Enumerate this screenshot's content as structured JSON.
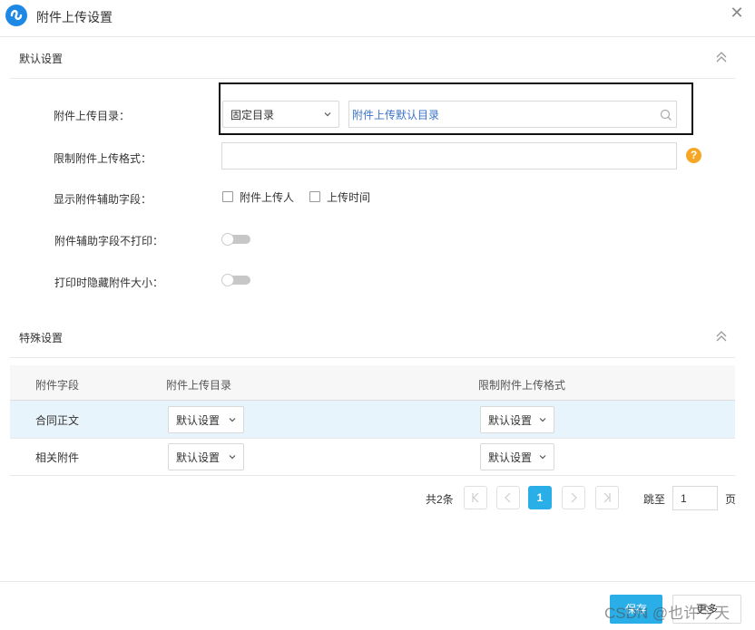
{
  "window": {
    "title": "附件上传设置",
    "close_glyph": "✕"
  },
  "default_section": {
    "title": "默认设置",
    "rows": {
      "upload_dir": {
        "label": "附件上传目录：",
        "select_value": "固定目录",
        "input_value": "附件上传默认目录"
      },
      "format": {
        "label": "限制附件上传格式：",
        "help_glyph": "?"
      },
      "aux_fields": {
        "label": "显示附件辅助字段：",
        "option1": "附件上传人",
        "option2": "上传时间"
      },
      "no_print": {
        "label": "附件辅助字段不打印："
      },
      "hide_size": {
        "label": "打印时隐藏附件大小："
      }
    }
  },
  "special_section": {
    "title": "特殊设置",
    "table": {
      "headers": [
        "附件字段",
        "附件上传目录",
        "限制附件上传格式"
      ],
      "rows": [
        {
          "field": "合同正文",
          "dir": "默认设置",
          "format": "默认设置"
        },
        {
          "field": "相关附件",
          "dir": "默认设置",
          "format": "默认设置"
        }
      ]
    },
    "pagination": {
      "total": "共2条",
      "current_page": "1",
      "jump_label": "跳至",
      "jump_value": "1",
      "page_unit": "页"
    }
  },
  "footer": {
    "save_label": "保存",
    "more_label": "更多",
    "watermark": "CSDN @也许今天"
  },
  "colors": {
    "accent": "#29aee8",
    "highlight_row": "#e8f4fb",
    "help": "#f5a623",
    "link_text": "#3b73c9"
  }
}
